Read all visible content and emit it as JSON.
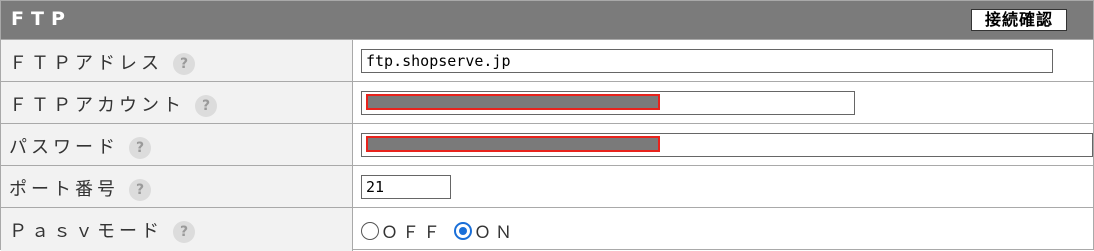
{
  "header": {
    "title": "FTP",
    "check_button_label": "接続確認"
  },
  "help_icon": "?",
  "rows": [
    {
      "label": "ＦＴＰアドレス",
      "value": "ftp.shopserve.jp"
    },
    {
      "label": "ＦＴＰアカウント",
      "value": ""
    },
    {
      "label": "パスワード",
      "value": ""
    },
    {
      "label": "ポート番号",
      "value": "21"
    },
    {
      "label": "Ｐａｓｖモード",
      "options": [
        "ＯＦＦ",
        "ＯＮ"
      ],
      "selected": "ＯＮ"
    }
  ],
  "colors": {
    "header_bg": "#7b7b7b",
    "label_bg": "#f2f2f2",
    "redaction_border": "#e8231c",
    "radio_accent": "#1a6fd8"
  }
}
